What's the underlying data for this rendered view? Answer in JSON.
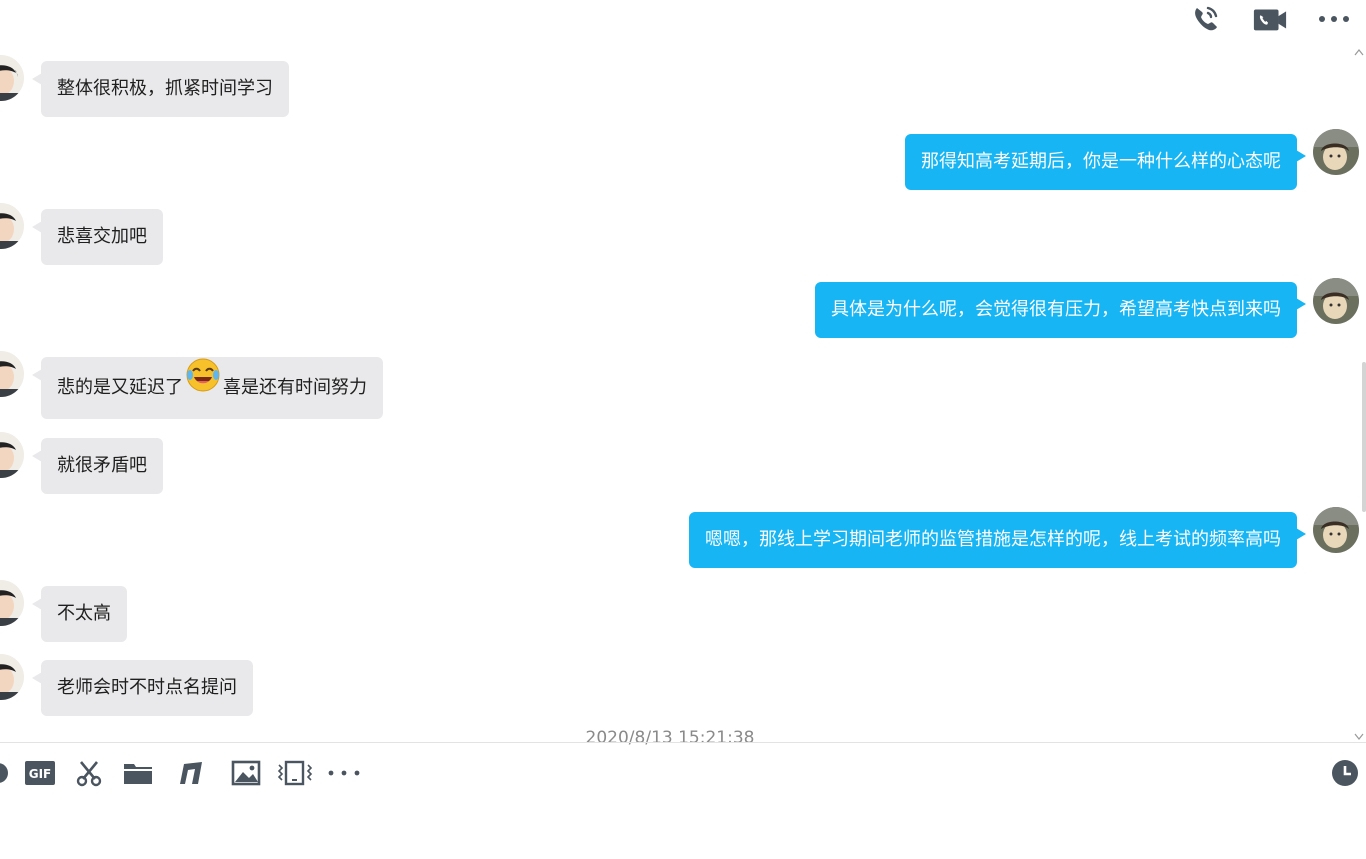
{
  "header": {
    "icons": [
      "phone-call-icon",
      "video-call-icon",
      "more-icon"
    ]
  },
  "messages": [
    {
      "side": "in",
      "text": "整体很积极，抓紧时间学习"
    },
    {
      "side": "out",
      "text": "那得知高考延期后，你是一种什么样的心态呢"
    },
    {
      "side": "in",
      "text": "悲喜交加吧"
    },
    {
      "side": "out",
      "text": "具体是为什么呢，会觉得很有压力，希望高考快点到来吗"
    },
    {
      "side": "in",
      "text_before": "悲的是又延迟了",
      "emoji": "laughing-tears-emoji",
      "text_after": "喜是还有时间努力"
    },
    {
      "side": "in",
      "text": "就很矛盾吧"
    },
    {
      "side": "out",
      "text": "嗯嗯，那线上学习期间老师的监管措施是怎样的呢，线上考试的频率高吗"
    },
    {
      "side": "in",
      "text": "不太高"
    },
    {
      "side": "in",
      "text": "老师会时不时点名提问"
    }
  ],
  "timestamp": "2020/8/13 15:21:38",
  "toolbar": {
    "icons": [
      "emoji-icon",
      "gif-icon",
      "scissors-icon",
      "folder-icon",
      "music-icon",
      "image-icon",
      "shake-icon",
      "more-icon",
      "history-icon"
    ],
    "gif_label": "GIF",
    "more_label": "•••"
  },
  "colors": {
    "incoming_bubble": "#e9e9eb",
    "outgoing_bubble": "#17b5f4",
    "icon": "#4a5560"
  }
}
